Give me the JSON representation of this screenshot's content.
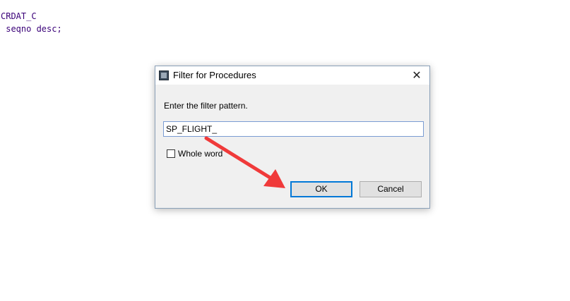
{
  "editor": {
    "lines": [
      "CRDAT_C",
      " seqno desc;"
    ]
  },
  "dialog": {
    "title": "Filter for Procedures",
    "close_label": "✕",
    "prompt": "Enter the filter pattern.",
    "filter_value": "SP_FLIGHT_",
    "whole_word_label": "Whole word",
    "whole_word_checked": false,
    "ok_label": "OK",
    "cancel_label": "Cancel"
  },
  "annotation": {
    "arrow_color": "#f03a3a"
  }
}
